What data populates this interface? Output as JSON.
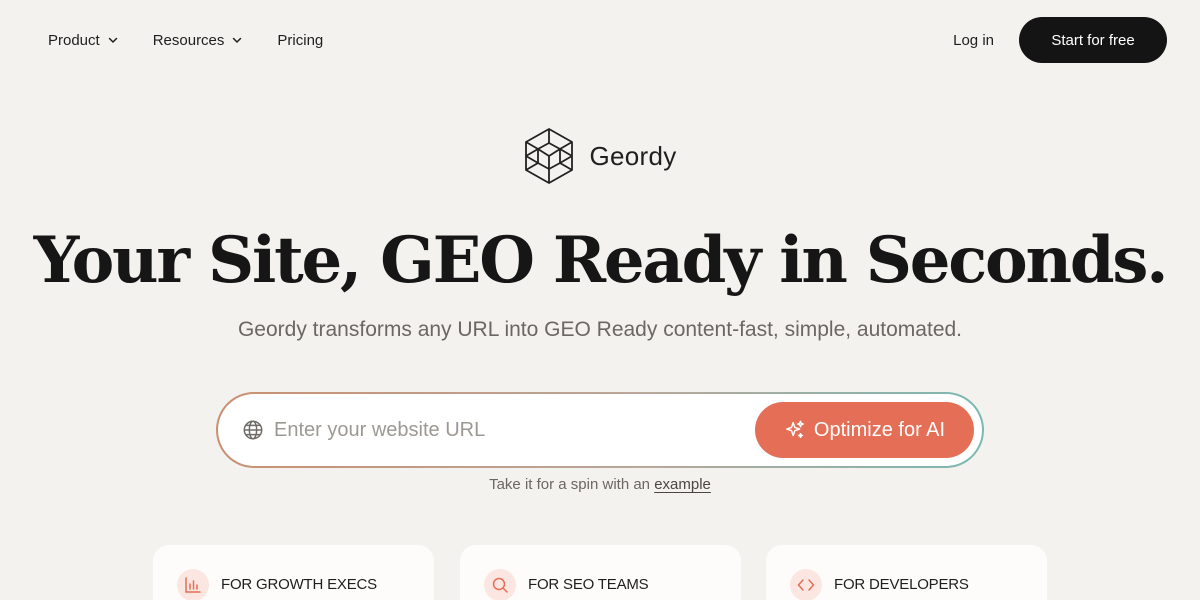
{
  "nav": {
    "items": [
      {
        "label": "Product",
        "has_dropdown": true
      },
      {
        "label": "Resources",
        "has_dropdown": true
      },
      {
        "label": "Pricing",
        "has_dropdown": false
      }
    ],
    "login_label": "Log in",
    "cta_label": "Start for free"
  },
  "brand": {
    "name": "Geordy",
    "logo_icon": "cube-lattice-icon"
  },
  "hero": {
    "headline": "Your Site, GEO Ready in Seconds.",
    "subheadline": "Geordy transforms any URL into GEO Ready content-fast, simple, automated."
  },
  "url_form": {
    "placeholder": "Enter your website URL",
    "value": "",
    "icon": "globe-icon",
    "button_label": "Optimize for AI",
    "button_icon": "sparkle-icon"
  },
  "hint": {
    "text": "Take it for a spin with an",
    "link_label": "example"
  },
  "cards": [
    {
      "title": "FOR GROWTH EXECS",
      "icon": "bar-chart-icon"
    },
    {
      "title": "FOR SEO TEAMS",
      "icon": "search-icon"
    },
    {
      "title": "FOR DEVELOPERS",
      "icon": "code-icon"
    }
  ],
  "colors": {
    "background": "#f4f2ee",
    "primary_button": "#141414",
    "accent": "#e56e56",
    "icon_tint": "#fbe6e1"
  }
}
